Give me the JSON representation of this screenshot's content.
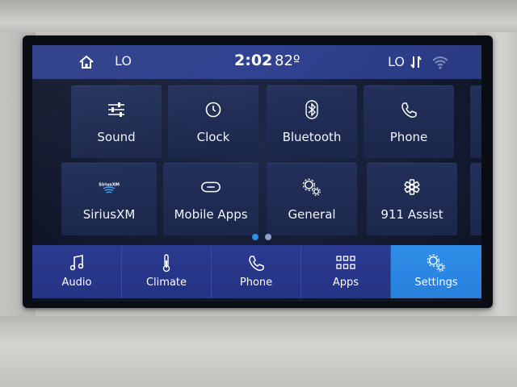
{
  "status_bar": {
    "driver_temp": "LO",
    "time": "2:02",
    "outside_temp": "82º",
    "passenger_temp": "LO"
  },
  "tiles": [
    {
      "label": "Sound",
      "icon": "sliders-icon"
    },
    {
      "label": "Clock",
      "icon": "clock-icon"
    },
    {
      "label": "Bluetooth",
      "icon": "bluetooth-icon"
    },
    {
      "label": "Phone",
      "icon": "phone-icon"
    },
    {
      "label": "SiriusXM",
      "icon": "siriusxm-icon"
    },
    {
      "label": "Mobile Apps",
      "icon": "link-icon"
    },
    {
      "label": "General",
      "icon": "gears-icon"
    },
    {
      "label": "911 Assist",
      "icon": "star-of-life-icon"
    }
  ],
  "pager": {
    "page_count": 2,
    "current_page": 1
  },
  "nav": [
    {
      "label": "Audio",
      "icon": "music-note-icon",
      "active": false
    },
    {
      "label": "Climate",
      "icon": "thermometer-icon",
      "active": false
    },
    {
      "label": "Phone",
      "icon": "phone-icon",
      "active": false
    },
    {
      "label": "Apps",
      "icon": "apps-grid-icon",
      "active": false
    },
    {
      "label": "Settings",
      "icon": "gears-icon",
      "active": true
    }
  ],
  "colors": {
    "status_bar": "#2c3f8f",
    "tile": "#1f2b52",
    "nav": "#27378a",
    "active": "#2a87e2",
    "dot_active": "#2f8fe6",
    "dot_inactive": "#8aa0cc"
  }
}
